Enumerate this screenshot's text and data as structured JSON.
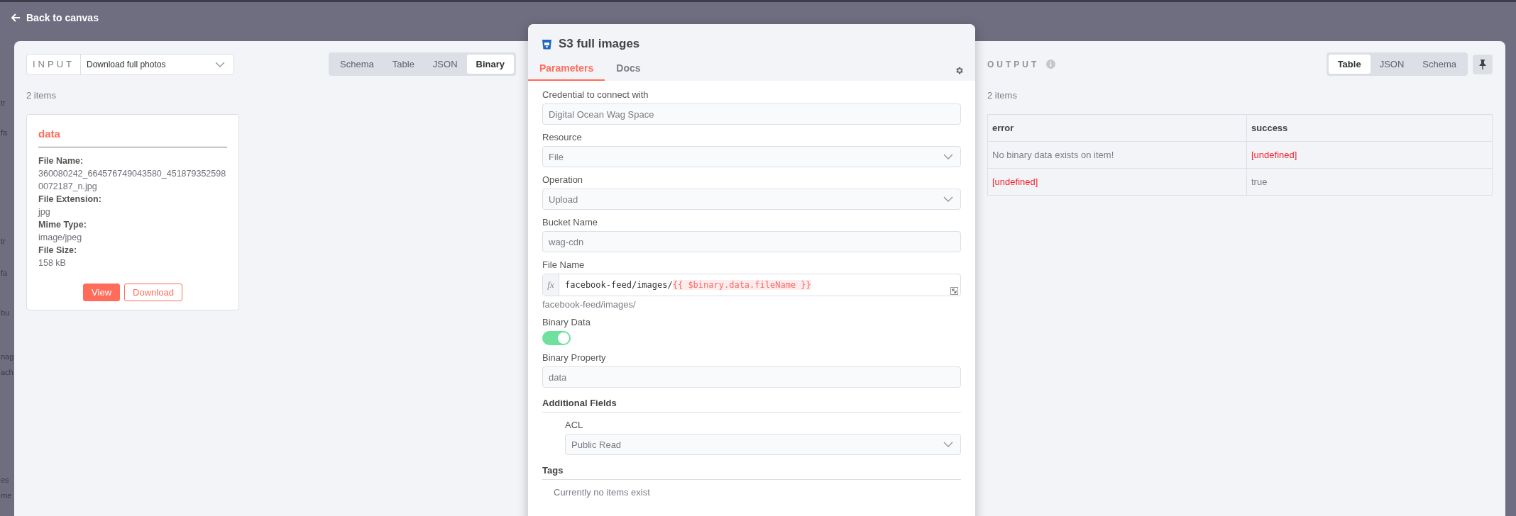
{
  "header": {
    "back_label": "Back to canvas"
  },
  "canvas_fragments": [
    "tr",
    "fa",
    "tr",
    "fa",
    "bu",
    "nag",
    "ach",
    "es",
    "me"
  ],
  "input": {
    "label": "INPUT",
    "node_select": "Download full photos",
    "views": [
      {
        "label": "Schema",
        "selected": false
      },
      {
        "label": "Table",
        "selected": false
      },
      {
        "label": "JSON",
        "selected": false
      },
      {
        "label": "Binary",
        "selected": true
      }
    ],
    "item_count": "2 items",
    "binary_card": {
      "title": "data",
      "fields": [
        {
          "label": "File Name:",
          "value": "360080242_664576749043580_4518793525980072187_n.jpg"
        },
        {
          "label": "File Extension:",
          "value": "jpg"
        },
        {
          "label": "Mime Type:",
          "value": "image/jpeg"
        },
        {
          "label": "File Size:",
          "value": "158 kB"
        }
      ],
      "buttons": [
        {
          "label": "View",
          "kind": "primary"
        },
        {
          "label": "Download",
          "kind": "secondary"
        }
      ]
    }
  },
  "node": {
    "title": "S3 full images",
    "tabs": [
      {
        "label": "Parameters",
        "selected": true
      },
      {
        "label": "Docs",
        "selected": false
      }
    ],
    "parameters": [
      {
        "kind": "input",
        "label": "Credential to connect with",
        "value": "Digital Ocean Wag Space"
      },
      {
        "kind": "select",
        "label": "Resource",
        "value": "File"
      },
      {
        "kind": "select",
        "label": "Operation",
        "value": "Upload"
      },
      {
        "kind": "input",
        "label": "Bucket Name",
        "value": "wag-cdn"
      },
      {
        "kind": "expression",
        "label": "File Name",
        "prefix_label": "fx",
        "value": "facebook-feed/images/",
        "expression": "{{ $binary.data.fileName }}",
        "hint": "facebook-feed/images/"
      },
      {
        "kind": "toggle",
        "label": "Binary Data",
        "on": true
      },
      {
        "kind": "input",
        "label": "Binary Property",
        "value": "data"
      },
      {
        "kind": "section",
        "label": "Additional Fields",
        "children": [
          {
            "kind": "select",
            "label": "ACL",
            "value": "Public Read"
          }
        ]
      },
      {
        "kind": "section",
        "label": "Tags",
        "empty_note": "Currently no items exist"
      }
    ]
  },
  "output": {
    "label": "OUTPUT",
    "views": [
      {
        "label": "Table",
        "selected": true
      },
      {
        "label": "JSON",
        "selected": false
      },
      {
        "label": "Schema",
        "selected": false
      }
    ],
    "item_count": "2 items",
    "table": {
      "columns": [
        "error",
        "success"
      ],
      "rows": [
        [
          {
            "kind": "text",
            "text": "No binary data exists on item!"
          },
          {
            "kind": "undefined",
            "text": "[undefined]"
          }
        ],
        [
          {
            "kind": "undefined",
            "text": "[undefined]"
          },
          {
            "kind": "text",
            "text": "true"
          }
        ]
      ]
    }
  }
}
